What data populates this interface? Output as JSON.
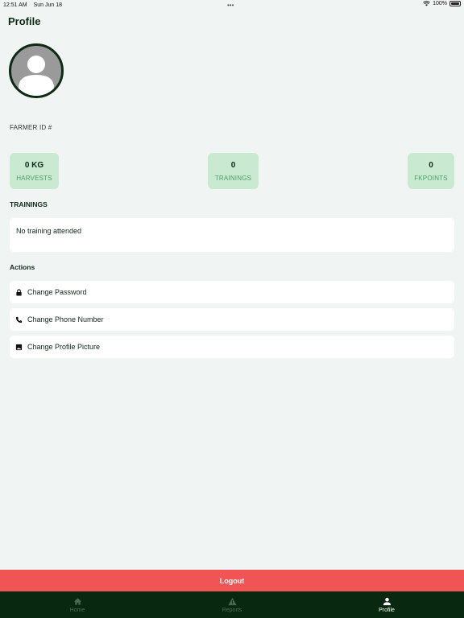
{
  "status_bar": {
    "time": "12:51 AM",
    "date": "Sun Jun 18",
    "battery": "100%"
  },
  "header": {
    "title": "Profile"
  },
  "profile": {
    "farmer_id_label": "FARMER ID #"
  },
  "stats": [
    {
      "value": "0 KG",
      "label": "HARVESTS"
    },
    {
      "value": "0",
      "label": "TRAININGS"
    },
    {
      "value": "0",
      "label": "FKPOINTS"
    }
  ],
  "trainings": {
    "title": "TRAININGS",
    "empty_text": "No training attended"
  },
  "actions": {
    "title": "Actions",
    "items": [
      {
        "label": "Change Password",
        "icon": "lock-icon"
      },
      {
        "label": "Change Phone Number",
        "icon": "phone-icon"
      },
      {
        "label": "Change Profile Picture",
        "icon": "image-icon"
      }
    ]
  },
  "logout_label": "Logout",
  "tabs": [
    {
      "label": "Home",
      "icon": "home-icon",
      "active": false
    },
    {
      "label": "Reports",
      "icon": "warning-icon",
      "active": false
    },
    {
      "label": "Profile",
      "icon": "person-icon",
      "active": true
    }
  ],
  "colors": {
    "background": "#f0f4f2",
    "primary_dark": "#08280f",
    "stat_bg": "#c9e9d0",
    "stat_label": "#49a067",
    "logout": "#f05454"
  }
}
